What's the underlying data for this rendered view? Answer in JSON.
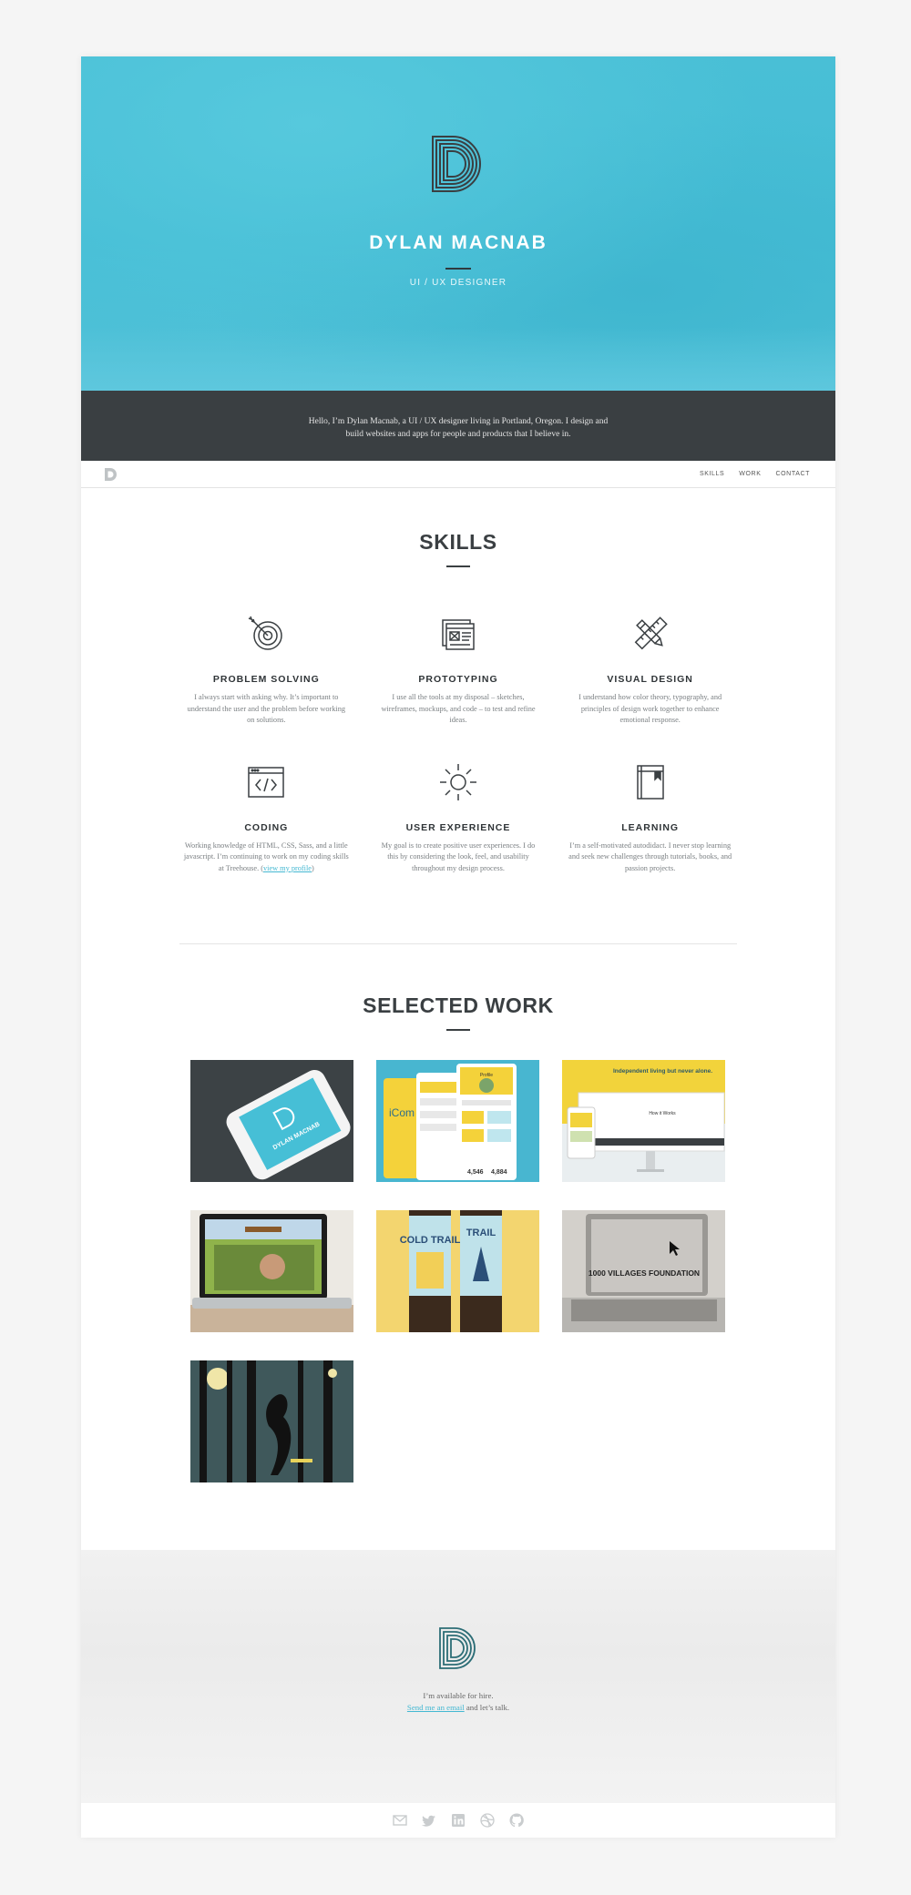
{
  "hero": {
    "name": "DYLAN MACNAB",
    "title": "UI / UX DESIGNER",
    "intro": "Hello, I’m Dylan Macnab, a UI / UX designer living in Portland, Oregon. I design and build websites and apps for people and products that I believe in."
  },
  "nav": {
    "links": [
      "SKILLS",
      "WORK",
      "CONTACT"
    ]
  },
  "skills": {
    "heading": "SKILLS",
    "items": [
      {
        "icon": "target-icon",
        "title": "PROBLEM SOLVING",
        "text": "I always start with asking why. It’s important to understand the user and the problem before working on solutions."
      },
      {
        "icon": "wireframe-icon",
        "title": "PROTOTYPING",
        "text": "I use all the tools at my disposal – sketches, wireframes, mockups, and code – to test and refine ideas."
      },
      {
        "icon": "pencil-ruler-icon",
        "title": "VISUAL DESIGN",
        "text": "I understand how color theory, typography, and principles of design work together to enhance emotional response."
      },
      {
        "icon": "code-icon",
        "title": "CODING",
        "text": "Working knowledge of HTML, CSS, Sass, and a little javascript. I’m continuing to work on my coding skills at Treehouse. (",
        "link": "view my profile",
        "after": ")"
      },
      {
        "icon": "sun-icon",
        "title": "USER EXPERIENCE",
        "text": "My goal is to create positive user experiences. I do this by considering the look, feel, and usability throughout my design process."
      },
      {
        "icon": "book-icon",
        "title": "LEARNING",
        "text": "I’m a self-motivated autodidact. I never stop learning and seek new challenges through tutorials, books, and passion projects."
      }
    ]
  },
  "work": {
    "heading": "SELECTED WORK",
    "tiles": [
      {
        "icon": "phone-portfolio-thumbnail",
        "phone_name": "DYLAN MACNAB",
        "bg": "#3c4245"
      },
      {
        "icon": "mobile-app-thumbnail",
        "bg": "#48b6d0",
        "stat1": "4,546",
        "stat2": "4,884",
        "app_word": "iCom",
        "app_title": "Profile"
      },
      {
        "icon": "responsive-site-thumbnail",
        "bg": "#f2d33b",
        "headline": "Independent living but never alone.",
        "sub": "How it Works"
      },
      {
        "icon": "laptop-video-thumbnail",
        "bg": "#e9e6e1"
      },
      {
        "icon": "beer-labels-thumbnail",
        "bg": "#f3d56f",
        "beer1": "COLD TRAIL",
        "beer2": "TRAIL"
      },
      {
        "icon": "laptop-foundation-thumbnail",
        "bg": "#d9d6d2",
        "label": "1000 VILLAGES FOUNDATION"
      },
      {
        "icon": "forest-illustration-thumbnail",
        "bg": "#3b5357"
      }
    ]
  },
  "footer": {
    "line1": "I’m available for hire.",
    "link": "Send me an email",
    "line2_after": " and let’s talk.",
    "social": [
      "mail-icon",
      "twitter-icon",
      "linkedin-icon",
      "dribbble-icon",
      "github-icon"
    ]
  },
  "colors": {
    "accent": "#44b8d2",
    "dark": "#3a3f42",
    "hero": "#49bfd6"
  }
}
